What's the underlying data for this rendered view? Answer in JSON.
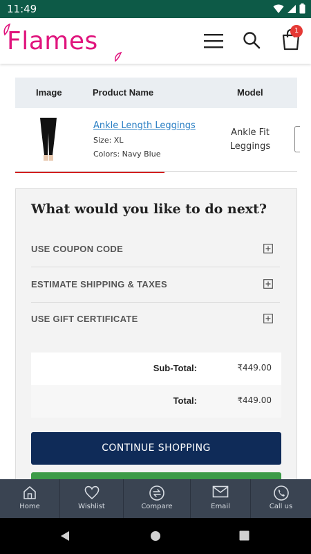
{
  "status_bar": {
    "time": "11:49"
  },
  "header": {
    "logo_text": "Flames",
    "cart_count": "1"
  },
  "cart_table": {
    "columns": {
      "image": "Image",
      "product_name": "Product Name",
      "model": "Model"
    },
    "item": {
      "name": "Ankle Length Leggings",
      "size": "Size: XL",
      "color": "Colors: Navy Blue",
      "model_line1": "Ankle Fit",
      "model_line2": "Leggings"
    }
  },
  "next_steps": {
    "title": "What would you like to do next?",
    "options": [
      {
        "label": "USE COUPON CODE"
      },
      {
        "label": "ESTIMATE SHIPPING & TAXES"
      },
      {
        "label": "USE GIFT CERTIFICATE"
      }
    ]
  },
  "totals": {
    "subtotal_label": "Sub-Total:",
    "subtotal_value": "₹449.00",
    "total_label": "Total:",
    "total_value": "₹449.00"
  },
  "buttons": {
    "continue_shopping": "CONTINUE SHOPPING"
  },
  "bottom_nav": {
    "items": [
      {
        "label": "Home",
        "icon": "home-icon"
      },
      {
        "label": "Wishlist",
        "icon": "heart-icon"
      },
      {
        "label": "Compare",
        "icon": "compare-icon"
      },
      {
        "label": "Email",
        "icon": "email-icon"
      },
      {
        "label": "Call us",
        "icon": "phone-icon"
      }
    ]
  },
  "colors": {
    "status_bar": "#0d5a47",
    "brand": "#e0147d",
    "primary_button": "#0f2b58",
    "checkout_button": "#3c9b47",
    "bottom_nav": "#3a4452",
    "link": "#2a7fc4"
  }
}
